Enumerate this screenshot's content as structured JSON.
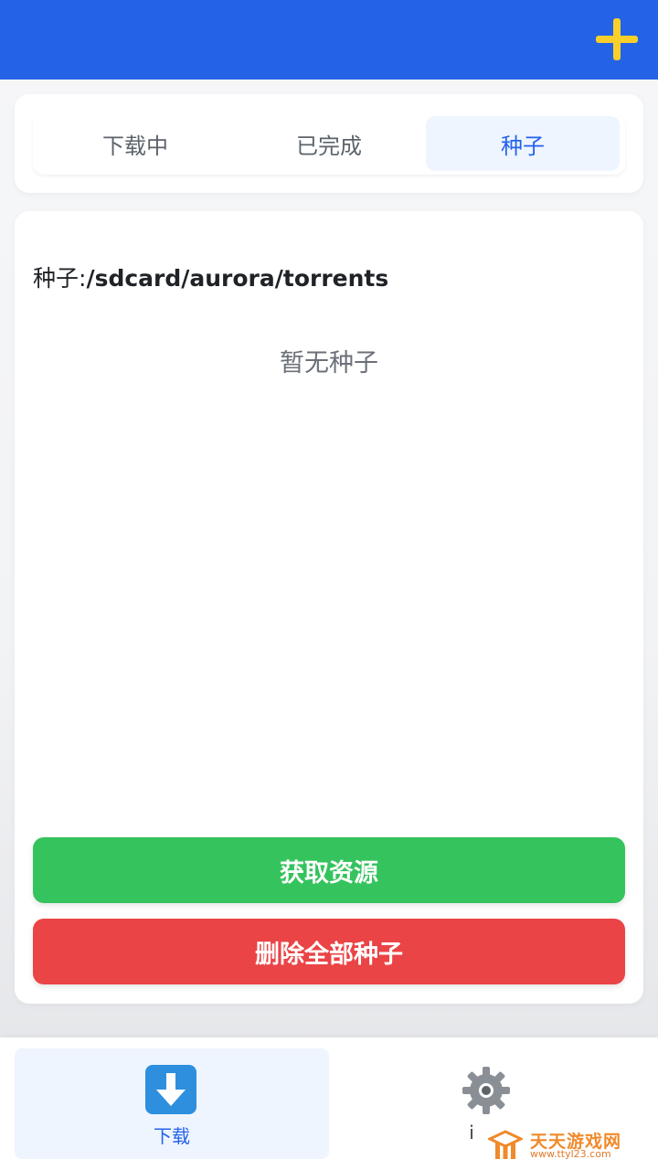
{
  "header": {
    "add_icon": "plus-icon",
    "accent_color": "#2463e6",
    "add_color": "#f9cf2c"
  },
  "tabs": [
    {
      "label": "下载中",
      "active": false
    },
    {
      "label": "已完成",
      "active": false
    },
    {
      "label": "种子",
      "active": true
    }
  ],
  "torrents": {
    "path_label": "种子:",
    "path_value": "/sdcard/aurora/torrents",
    "empty_text": "暂无种子"
  },
  "actions": {
    "get_resources_label": "获取资源",
    "get_resources_color": "#35c35d",
    "delete_all_label": "删除全部种子",
    "delete_all_color": "#ea4446"
  },
  "bottom_nav": [
    {
      "label": "下载",
      "icon": "download-arrow-icon",
      "active": true
    },
    {
      "label": "i",
      "icon": "gear-icon",
      "active": false
    }
  ],
  "watermark": {
    "title": "天天游戏网",
    "url": "www.ttyl23.com"
  }
}
